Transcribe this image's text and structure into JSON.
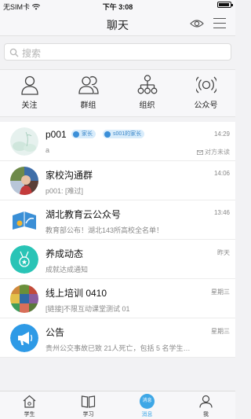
{
  "status_bar": {
    "carrier": "无SIM卡",
    "time": "下午 3:08",
    "battery_percent": 95
  },
  "header": {
    "title": "聊天",
    "icons": [
      "eye-icon",
      "menu-icon"
    ]
  },
  "search": {
    "placeholder": "搜索"
  },
  "quick_actions": [
    {
      "label": "关注",
      "icon": "person-icon"
    },
    {
      "label": "群组",
      "icon": "group-icon"
    },
    {
      "label": "组织",
      "icon": "org-chart-icon"
    },
    {
      "label": "公众号",
      "icon": "broadcast-icon"
    }
  ],
  "conversations": [
    {
      "name": "p001",
      "tags": [
        "家长",
        "s001的家长"
      ],
      "preview": "a",
      "time": "14:29",
      "status": "对方未读"
    },
    {
      "name": "家校沟通群",
      "preview": "p001: [难过]",
      "time": "14:06"
    },
    {
      "name": "湖北教育云公众号",
      "preview": "教育部公布！湖北143所高校全名单！",
      "time": "13:46"
    },
    {
      "name": "养成动态",
      "preview": "成就达成通知",
      "time": "昨天"
    },
    {
      "name": "线上培训 0410",
      "preview": "[链接]不限互动课堂测试 01",
      "time": "星期三"
    },
    {
      "name": "公告",
      "preview": "贵州公交事故已致 21人死亡，包括 5 名学生…",
      "time": "星期三"
    }
  ],
  "tabs": [
    {
      "label": "学生",
      "icon": "house-icon"
    },
    {
      "label": "学习",
      "icon": "book-icon"
    },
    {
      "label": "消息",
      "icon": "message-icon",
      "active": true
    },
    {
      "label": "我",
      "icon": "profile-icon"
    }
  ],
  "colors": {
    "accent": "#3ea7e6",
    "tag_bg": "#d8ecfb",
    "tag_text": "#3a86c8"
  }
}
